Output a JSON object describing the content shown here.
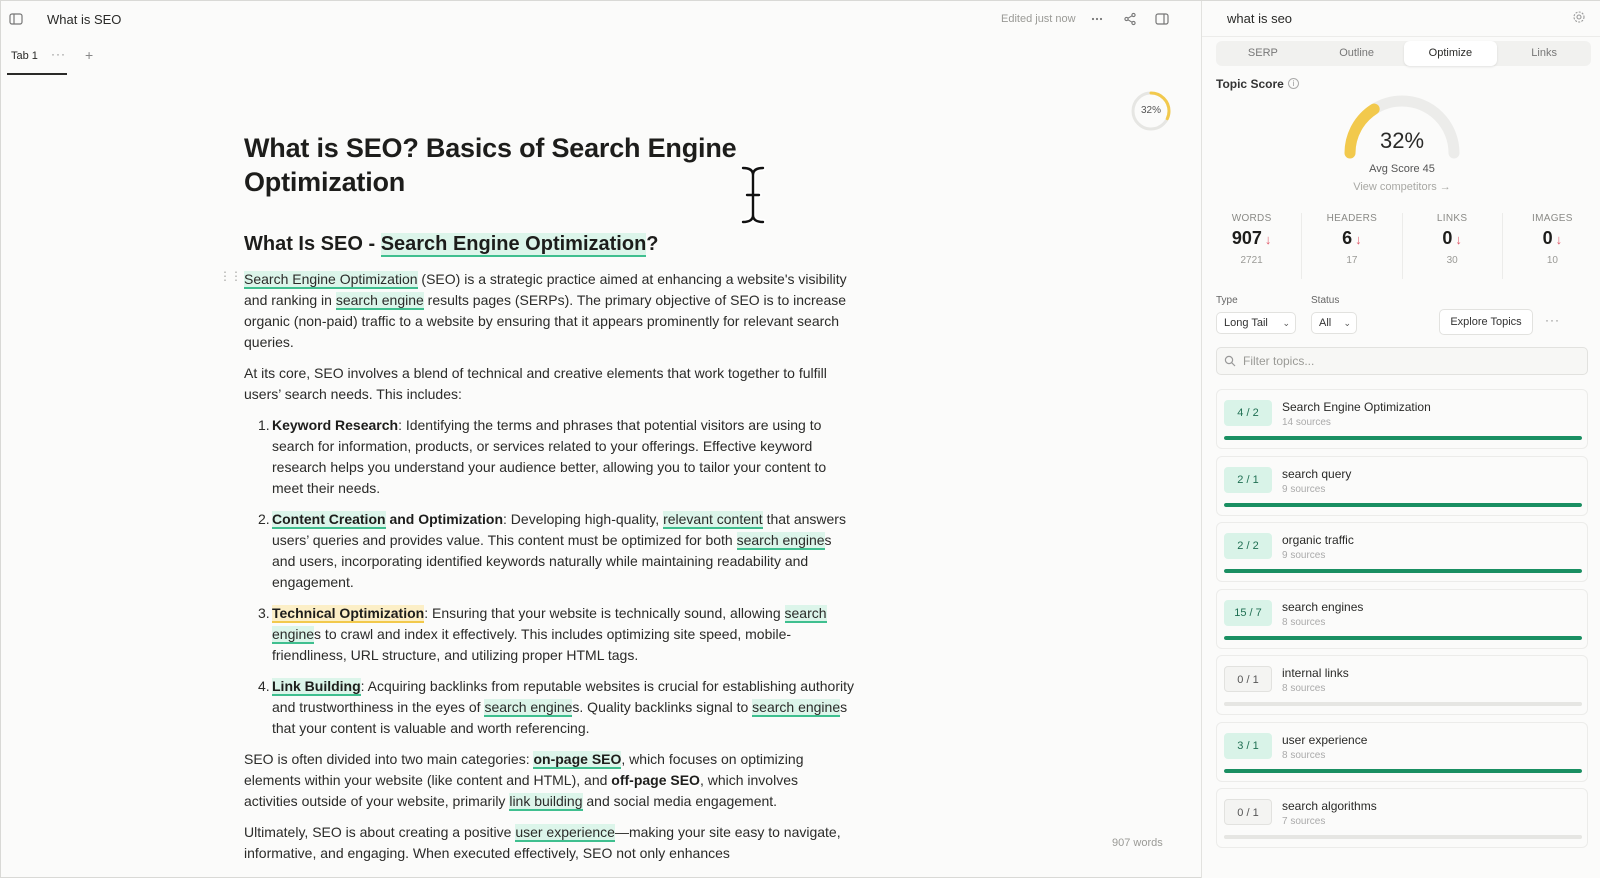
{
  "header": {
    "doc_title": "What is SEO",
    "edited_status": "Edited just now"
  },
  "tabs": [
    {
      "label": "Tab 1"
    }
  ],
  "editor": {
    "score_ring": "32%",
    "score_fraction": 0.32,
    "word_count": "907 words",
    "title": "What is SEO? Basics of Search Engine Optimization",
    "h2_prefix": "What Is SEO - ",
    "h2_keyword": "Search Engine Optimization",
    "h2_suffix": "?",
    "intro": {
      "kw1": "Search Engine Optimization",
      "t1": " (SEO) is a strategic practice aimed at enhancing a website's visibility and ranking in ",
      "kw2": "search engine",
      "t2": " results pages (SERPs). The primary objective of SEO is to increase organic (non-paid) traffic to a website by ensuring that it appears prominently for relevant search queries."
    },
    "p2": "At its core, SEO involves a blend of technical and creative elements that work together to fulfill users’ search needs. This includes:",
    "list": {
      "i1": {
        "num": "1.",
        "bold": "Keyword Research",
        "text": ": Identifying the terms and phrases that potential visitors are using to search for information, products, or services related to your offerings. Effective keyword research helps you understand your audience better, allowing you to tailor your content to meet their needs."
      },
      "i2": {
        "num": "2.",
        "bold_kw": "Content Creation",
        "bold": " and Optimization",
        "t1": ": Developing high-quality, ",
        "kw1": "relevant content",
        "t2": " that answers users’ queries and provides value. This content must be optimized for both ",
        "kw2": "search engine",
        "t3": "s and users, incorporating identified keywords naturally while maintaining readability and engagement."
      },
      "i3": {
        "num": "3.",
        "bold_kw": "Technical Optimization",
        "t1": ": Ensuring that your website is technically sound, allowing ",
        "kw1": "search engine",
        "t2": "s to crawl and index it effectively. This includes optimizing site speed, mobile-friendliness, URL structure, and utilizing proper HTML tags."
      },
      "i4": {
        "num": "4.",
        "bold_kw": "Link Building",
        "t1": ": Acquiring backlinks from reputable websites is crucial for establishing authority and trustworthiness in the eyes of ",
        "kw1": "search engine",
        "t2": "s. Quality backlinks signal to ",
        "kw2": "search engine",
        "t3": "s that your content is valuable and worth referencing."
      }
    },
    "p3": {
      "t1": "SEO is often divided into two main categories: ",
      "kw1": "on-page SEO",
      "t2": ", which focuses on optimizing elements within your website (like content and HTML), and ",
      "b1": "off-page SEO",
      "t3": ", which involves activities outside of your website, primarily ",
      "kw2": "link building",
      "t4": " and social media engagement."
    },
    "p4": {
      "t1": "Ultimately, SEO is about creating a positive ",
      "kw1": "user experience",
      "t2": "—making your site easy to navigate, informative, and engaging. When executed effectively, SEO not only enhances"
    }
  },
  "panel": {
    "search_query": "what is seo",
    "tabs": [
      {
        "label": "SERP",
        "active": false
      },
      {
        "label": "Outline",
        "active": false
      },
      {
        "label": "Optimize",
        "active": true
      },
      {
        "label": "Links",
        "active": false
      }
    ],
    "topic_score_label": "Topic Score",
    "score": "32%",
    "score_fraction": 0.32,
    "avg_score": "Avg Score 45",
    "view_competitors": "View competitors →",
    "stats": [
      {
        "label": "WORDS",
        "value": "907",
        "arrow": "↓",
        "target": "2721"
      },
      {
        "label": "HEADERS",
        "value": "6",
        "arrow": "↓",
        "target": "17"
      },
      {
        "label": "LINKS",
        "value": "0",
        "arrow": "↓",
        "target": "30"
      },
      {
        "label": "IMAGES",
        "value": "0",
        "arrow": "↓",
        "target": "10"
      }
    ],
    "type_label": "Type",
    "type_value": "Long Tail",
    "status_label": "Status",
    "status_value": "All",
    "explore_topics": "Explore Topics",
    "filter_placeholder": "Filter topics...",
    "topics": [
      {
        "badge": "4 / 2",
        "name": "Search Engine Optimization",
        "sources": "14 sources",
        "progress": 1.0,
        "zero": false
      },
      {
        "badge": "2 / 1",
        "name": "search query",
        "sources": "9 sources",
        "progress": 1.0,
        "zero": false
      },
      {
        "badge": "2 / 2",
        "name": "organic traffic",
        "sources": "9 sources",
        "progress": 1.0,
        "zero": false
      },
      {
        "badge": "15 / 7",
        "name": "search engines",
        "sources": "8 sources",
        "progress": 1.0,
        "zero": false
      },
      {
        "badge": "0 / 1",
        "name": "internal links",
        "sources": "8 sources",
        "progress": 0.0,
        "zero": true
      },
      {
        "badge": "3 / 1",
        "name": "user experience",
        "sources": "8 sources",
        "progress": 1.0,
        "zero": false
      },
      {
        "badge": "0 / 1",
        "name": "search algorithms",
        "sources": "7 sources",
        "progress": 0.0,
        "zero": true
      }
    ]
  },
  "colors": {
    "accent_green": "#1a8f62",
    "keyword_highlight": "#dcf5ea",
    "keyword_underline": "#3fbf8f",
    "technical_highlight": "#fcefc7",
    "gauge_yellow": "#f2c94c",
    "down_arrow": "#e05a6a"
  }
}
